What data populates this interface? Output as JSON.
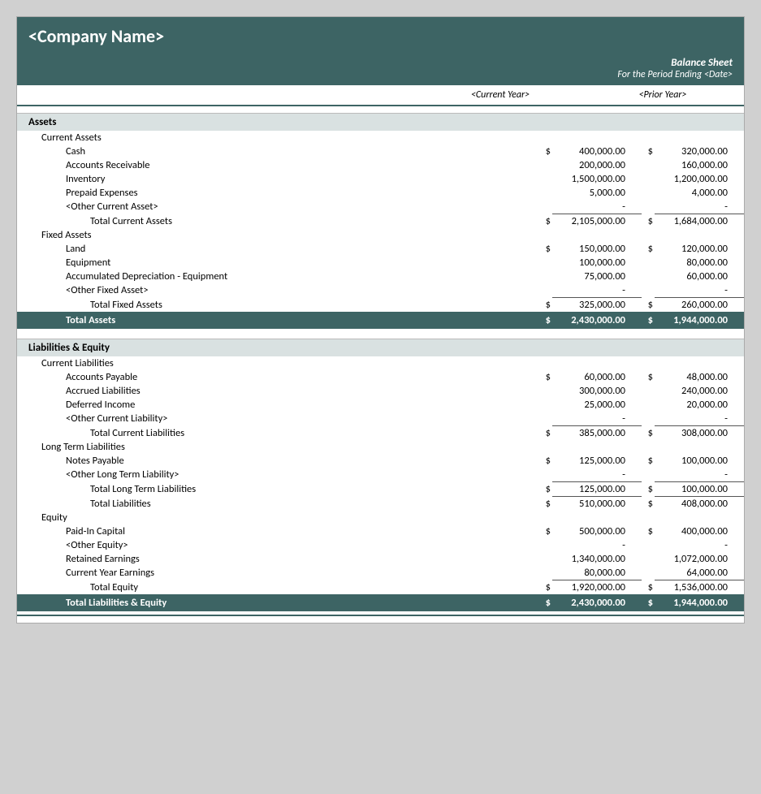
{
  "header": {
    "company_name": "<Company Name>",
    "report_title": "Balance Sheet",
    "period_label": "For the Period Ending <Date>",
    "col_cy": "<Current Year>",
    "col_py": "<Prior Year>"
  },
  "assets": {
    "section_label": "Assets",
    "current_assets": {
      "group_label": "Current Assets",
      "items": [
        {
          "label": "Cash",
          "dollar": "$",
          "cy": "400,000.00",
          "cy_dollar": "$",
          "py": "320,000.00"
        },
        {
          "label": "Accounts Receivable",
          "dollar": "",
          "cy": "200,000.00",
          "cy_dollar": "",
          "py": "160,000.00"
        },
        {
          "label": "Inventory",
          "dollar": "",
          "cy": "1,500,000.00",
          "cy_dollar": "",
          "py": "1,200,000.00"
        },
        {
          "label": "Prepaid Expenses",
          "dollar": "",
          "cy": "5,000.00",
          "cy_dollar": "",
          "py": "4,000.00"
        },
        {
          "label": "<Other Current Asset>",
          "dollar": "",
          "cy": "-",
          "cy_dollar": "",
          "py": "-"
        }
      ],
      "total_label": "Total Current Assets",
      "total_dollar": "$",
      "total_cy": "2,105,000.00",
      "total_cy_dollar": "$",
      "total_py": "1,684,000.00"
    },
    "fixed_assets": {
      "group_label": "Fixed Assets",
      "items": [
        {
          "label": "Land",
          "dollar": "$",
          "cy": "150,000.00",
          "cy_dollar": "$",
          "py": "120,000.00"
        },
        {
          "label": "Equipment",
          "dollar": "",
          "cy": "100,000.00",
          "cy_dollar": "",
          "py": "80,000.00"
        },
        {
          "label": "Accumulated Depreciation - Equipment",
          "dollar": "",
          "cy": "75,000.00",
          "cy_dollar": "",
          "py": "60,000.00"
        },
        {
          "label": "<Other Fixed Asset>",
          "dollar": "",
          "cy": "-",
          "cy_dollar": "",
          "py": "-"
        }
      ],
      "total_label": "Total Fixed Assets",
      "total_dollar": "$",
      "total_cy": "325,000.00",
      "total_cy_dollar": "$",
      "total_py": "260,000.00"
    },
    "grand_total_label": "Total Assets",
    "grand_total_dollar": "$",
    "grand_total_cy": "2,430,000.00",
    "grand_total_cy_dollar": "$",
    "grand_total_py": "1,944,000.00"
  },
  "liabilities_equity": {
    "section_label": "Liabilities & Equity",
    "current_liabilities": {
      "group_label": "Current Liabilities",
      "items": [
        {
          "label": "Accounts Payable",
          "dollar": "$",
          "cy": "60,000.00",
          "cy_dollar": "$",
          "py": "48,000.00"
        },
        {
          "label": "Accrued Liabilities",
          "dollar": "",
          "cy": "300,000.00",
          "cy_dollar": "",
          "py": "240,000.00"
        },
        {
          "label": "Deferred Income",
          "dollar": "",
          "cy": "25,000.00",
          "cy_dollar": "",
          "py": "20,000.00"
        },
        {
          "label": "<Other Current Liability>",
          "dollar": "",
          "cy": "-",
          "cy_dollar": "",
          "py": "-"
        }
      ],
      "total_label": "Total Current Liabilities",
      "total_dollar": "$",
      "total_cy": "385,000.00",
      "total_cy_dollar": "$",
      "total_py": "308,000.00"
    },
    "long_term_liabilities": {
      "group_label": "Long Term Liabilities",
      "items": [
        {
          "label": "Notes Payable",
          "dollar": "$",
          "cy": "125,000.00",
          "cy_dollar": "$",
          "py": "100,000.00"
        },
        {
          "label": "<Other Long Term Liability>",
          "dollar": "",
          "cy": "-",
          "cy_dollar": "",
          "py": "-"
        }
      ],
      "total_lt_label": "Total Long Term Liabilities",
      "total_lt_dollar": "$",
      "total_lt_cy": "125,000.00",
      "total_lt_cy_dollar": "$",
      "total_lt_py": "100,000.00",
      "total_liab_label": "Total Liabilities",
      "total_liab_dollar": "$",
      "total_liab_cy": "510,000.00",
      "total_liab_cy_dollar": "$",
      "total_liab_py": "408,000.00"
    },
    "equity": {
      "group_label": "Equity",
      "items": [
        {
          "label": "Paid-In Capital",
          "dollar": "$",
          "cy": "500,000.00",
          "cy_dollar": "$",
          "py": "400,000.00"
        },
        {
          "label": "<Other Equity>",
          "dollar": "",
          "cy": "-",
          "cy_dollar": "",
          "py": "-"
        },
        {
          "label": "Retained Earnings",
          "dollar": "",
          "cy": "1,340,000.00",
          "cy_dollar": "",
          "py": "1,072,000.00"
        },
        {
          "label": "Current Year Earnings",
          "dollar": "",
          "cy": "80,000.00",
          "cy_dollar": "",
          "py": "64,000.00"
        }
      ],
      "total_label": "Total Equity",
      "total_dollar": "$",
      "total_cy": "1,920,000.00",
      "total_cy_dollar": "$",
      "total_py": "1,536,000.00"
    },
    "grand_total_label": "Total Liabilities & Equity",
    "grand_total_dollar": "$",
    "grand_total_cy": "2,430,000.00",
    "grand_total_cy_dollar": "$",
    "grand_total_py": "1,944,000.00"
  }
}
